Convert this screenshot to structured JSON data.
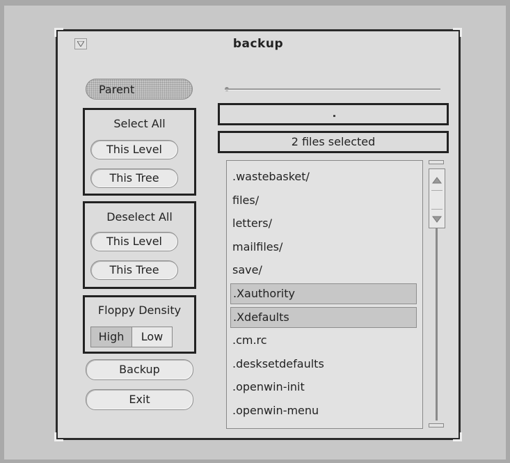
{
  "window": {
    "title": "backup"
  },
  "left": {
    "parent_label": "Parent",
    "select_all": {
      "title": "Select All",
      "this_level": "This Level",
      "this_tree": "This Tree"
    },
    "deselect_all": {
      "title": "Deselect All",
      "this_level": "This Level",
      "this_tree": "This Tree"
    },
    "floppy": {
      "title": "Floppy Density",
      "options": [
        "High",
        "Low"
      ],
      "selected": "High"
    },
    "backup_label": "Backup",
    "exit_label": "Exit"
  },
  "right": {
    "current_field": ".",
    "status": "2 files selected",
    "files": [
      {
        "name": ".wastebasket/",
        "selected": false
      },
      {
        "name": "files/",
        "selected": false
      },
      {
        "name": "letters/",
        "selected": false
      },
      {
        "name": "mailfiles/",
        "selected": false
      },
      {
        "name": "save/",
        "selected": false
      },
      {
        "name": ".Xauthority",
        "selected": true
      },
      {
        "name": ".Xdefaults",
        "selected": true
      },
      {
        "name": ".cm.rc",
        "selected": false
      },
      {
        "name": ".desksetdefaults",
        "selected": false
      },
      {
        "name": ".openwin-init",
        "selected": false
      },
      {
        "name": ".openwin-menu",
        "selected": false
      }
    ]
  },
  "colors": {
    "selected_bg": "#c7c7c7",
    "window_bg": "#dcdcdc",
    "desktop_bg": "#c8c8c8"
  }
}
